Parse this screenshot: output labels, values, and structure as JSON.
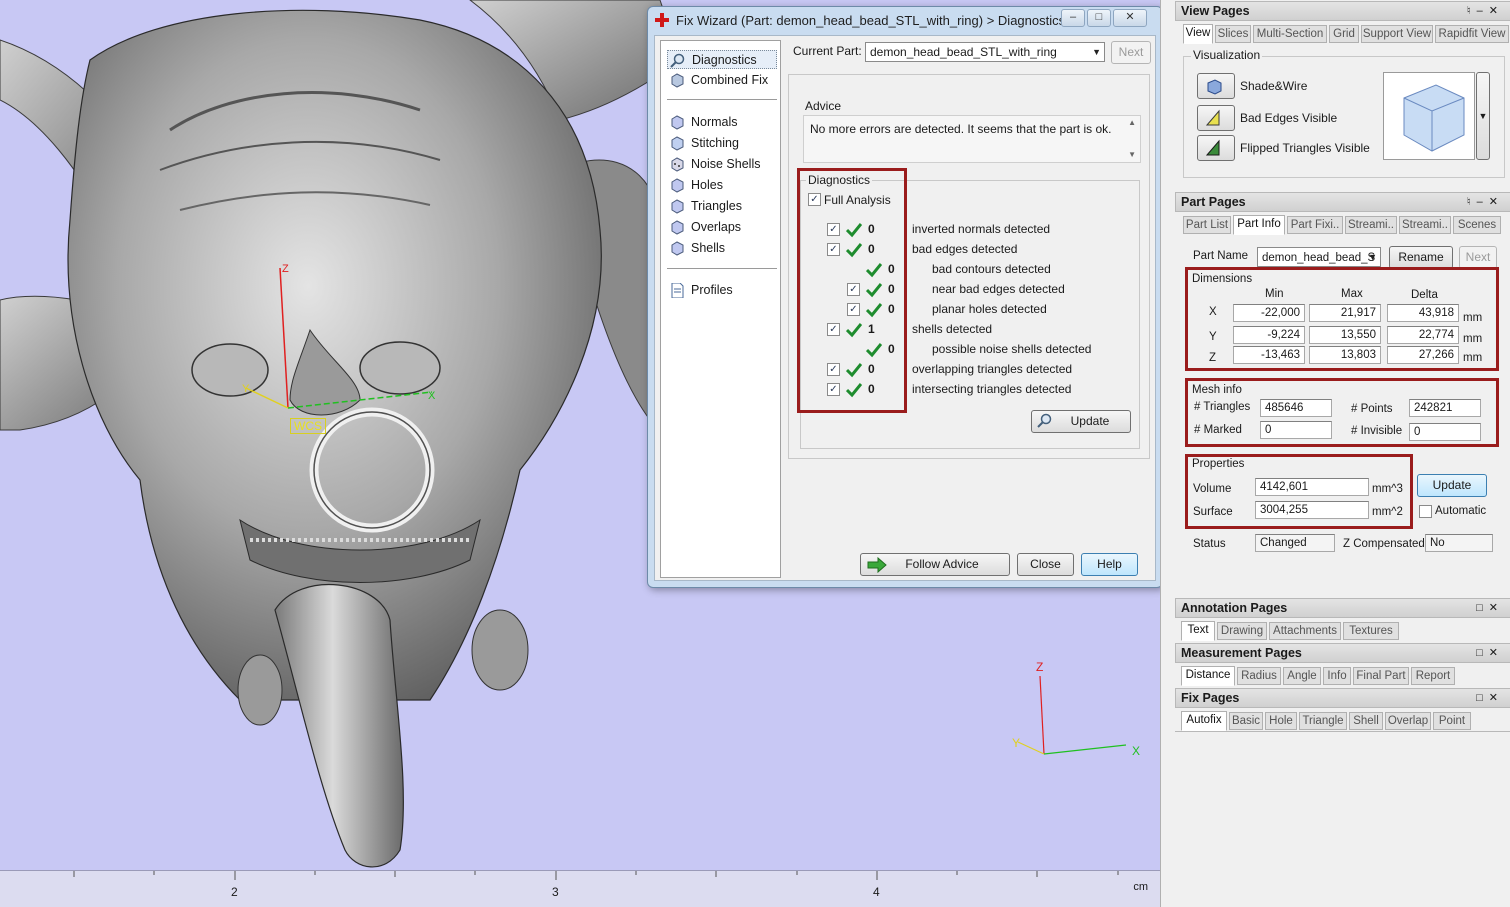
{
  "viewport": {
    "wcs_label": "WCS",
    "axis_labels": {
      "z": "Z",
      "y": "Y",
      "x": "X"
    },
    "ruler": {
      "ticks": [
        "2",
        "3",
        "4"
      ],
      "unit": "cm"
    },
    "colors": {
      "background": "#c8c8f4",
      "z_axis": "#e02020",
      "x_axis": "#20c020",
      "y_axis": "#e0d020"
    }
  },
  "fix_wizard": {
    "title": "Fix Wizard (Part: demon_head_bead_STL_with_ring) > Diagnostics",
    "nav": {
      "top": [
        "Diagnostics",
        "Combined Fix"
      ],
      "fixes": [
        "Normals",
        "Stitching",
        "Noise Shells",
        "Holes",
        "Triangles",
        "Overlaps",
        "Shells"
      ],
      "bottom": [
        "Profiles"
      ]
    },
    "current_part_label": "Current Part:",
    "current_part_value": "demon_head_bead_STL_with_ring",
    "next_label": "Next",
    "advice": {
      "title": "Advice",
      "text": "No more errors are detected. It seems that the part is ok."
    },
    "diagnostics": {
      "title": "Diagnostics",
      "full_analysis_label": "Full Analysis",
      "rows": [
        {
          "count": "0",
          "label": "inverted normals detected"
        },
        {
          "count": "0",
          "label": "bad edges detected"
        },
        {
          "count": "0",
          "label": "bad contours detected"
        },
        {
          "count": "0",
          "label": "near bad edges detected"
        },
        {
          "count": "0",
          "label": "planar holes detected"
        },
        {
          "count": "1",
          "label": "shells detected"
        },
        {
          "count": "0",
          "label": "possible noise shells detected"
        },
        {
          "count": "0",
          "label": "overlapping triangles detected"
        },
        {
          "count": "0",
          "label": "intersecting triangles detected"
        }
      ],
      "update_label": "Update"
    },
    "buttons": {
      "follow_advice": "Follow Advice",
      "close": "Close",
      "help": "Help"
    }
  },
  "view_pages": {
    "title": "View Pages",
    "tabs": [
      "View",
      "Slices",
      "Multi-Section",
      "Grid",
      "Support View",
      "Rapidfit View"
    ],
    "visualization_title": "Visualization",
    "items": [
      "Shade&Wire",
      "Bad Edges Visible",
      "Flipped Triangles Visible"
    ]
  },
  "part_pages": {
    "title": "Part Pages",
    "tabs": [
      "Part List",
      "Part Info",
      "Part Fixi..",
      "Streami..",
      "Streami..",
      "Scenes"
    ],
    "part_name_label": "Part Name",
    "part_name_value": "demon_head_bead_S",
    "rename_label": "Rename",
    "next_label": "Next",
    "dimensions": {
      "title": "Dimensions",
      "headers": [
        "Min",
        "Max",
        "Delta"
      ],
      "rows": [
        {
          "axis": "X",
          "min": "-22,000",
          "max": "21,917",
          "delta": "43,918",
          "unit": "mm"
        },
        {
          "axis": "Y",
          "min": "-9,224",
          "max": "13,550",
          "delta": "22,774",
          "unit": "mm"
        },
        {
          "axis": "Z",
          "min": "-13,463",
          "max": "13,803",
          "delta": "27,266",
          "unit": "mm"
        }
      ]
    },
    "mesh_info": {
      "title": "Mesh info",
      "triangles_label": "# Triangles",
      "triangles_value": "485646",
      "points_label": "# Points",
      "points_value": "242821",
      "marked_label": "# Marked",
      "marked_value": "0",
      "invisible_label": "# Invisible",
      "invisible_value": "0"
    },
    "properties": {
      "title": "Properties",
      "volume_label": "Volume",
      "volume_value": "4142,601",
      "volume_unit": "mm^3",
      "surface_label": "Surface",
      "surface_value": "3004,255",
      "surface_unit": "mm^2",
      "update_label": "Update",
      "automatic_label": "Automatic"
    },
    "status_label": "Status",
    "status_value": "Changed",
    "zcomp_label": "Z Compensated",
    "zcomp_value": "No"
  },
  "annotation_pages": {
    "title": "Annotation Pages",
    "tabs": [
      "Text",
      "Drawing",
      "Attachments",
      "Textures"
    ]
  },
  "measurement_pages": {
    "title": "Measurement Pages",
    "tabs": [
      "Distance",
      "Radius",
      "Angle",
      "Info",
      "Final Part",
      "Report"
    ]
  },
  "fix_pages": {
    "title": "Fix Pages",
    "tabs": [
      "Autofix",
      "Basic",
      "Hole",
      "Triangle",
      "Shell",
      "Overlap",
      "Point"
    ]
  }
}
